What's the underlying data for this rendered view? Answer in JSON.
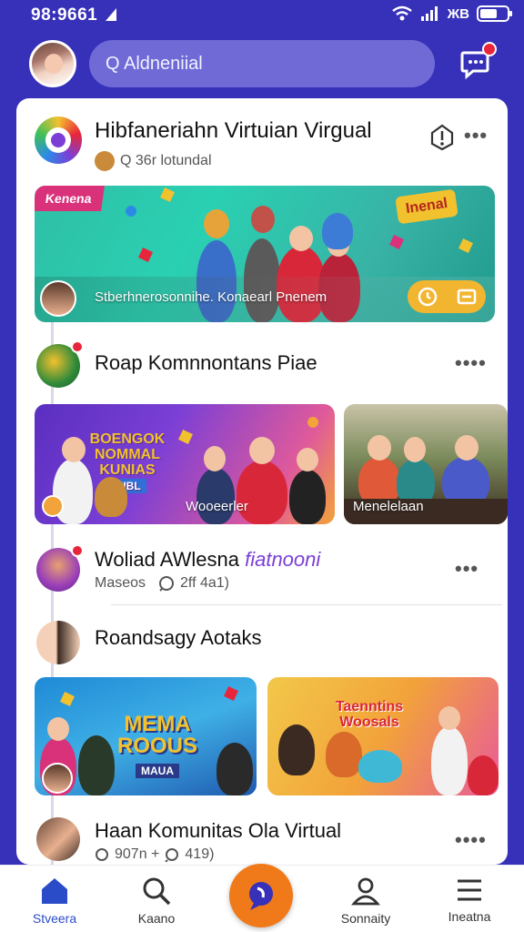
{
  "status_bar": {
    "time": "98:9661",
    "carrier": "ЖВ"
  },
  "header": {
    "search_placeholder": "Q Aldneniial",
    "chat_badge_color": "#e8263b"
  },
  "community": {
    "title": "Hibfaneriahn Virtuian Virgual",
    "subtitle": "Q 36r lotundal",
    "more": "•••"
  },
  "featured_banner": {
    "tag_left": "Kenena",
    "tag_right": "Inenal",
    "caption": "Stberhnerosonnihe. Konaearl Pnenem"
  },
  "feed": [
    {
      "title": "Roap Komnnontans Piae",
      "more": "••••"
    },
    {
      "title_main": "Woliad AWlesna",
      "title_accent": "fiatnooni",
      "sub_left": "Maseos",
      "sub_right": "2ff 4a1)",
      "more": "•••"
    },
    {
      "title": "Roandsagy Aotaks"
    },
    {
      "title": "Haan Komunitas Ola Virtual",
      "sub_left": "907n +",
      "sub_right": "419)",
      "more": "••••"
    }
  ],
  "row1_banners": [
    {
      "headline": "BOENGOK NOMMAL KUNIAS",
      "sub": "MIBL",
      "caption": "Wooeerler"
    },
    {
      "caption": "Menelelaan"
    }
  ],
  "row2_banners": [
    {
      "headline": "MEMA ROOUS",
      "sub": "MAUA"
    },
    {
      "headline": "Taenntins Woosals"
    }
  ],
  "bottom_nav": [
    {
      "label": "Stveera",
      "active": true
    },
    {
      "label": "Kaano"
    },
    {
      "label": "Sonnaity"
    },
    {
      "label": "Ineatna"
    }
  ],
  "colors": {
    "brand": "#3730b8",
    "accent": "#f07a1a",
    "alert": "#e8263b",
    "active_nav": "#2b4cc9"
  }
}
